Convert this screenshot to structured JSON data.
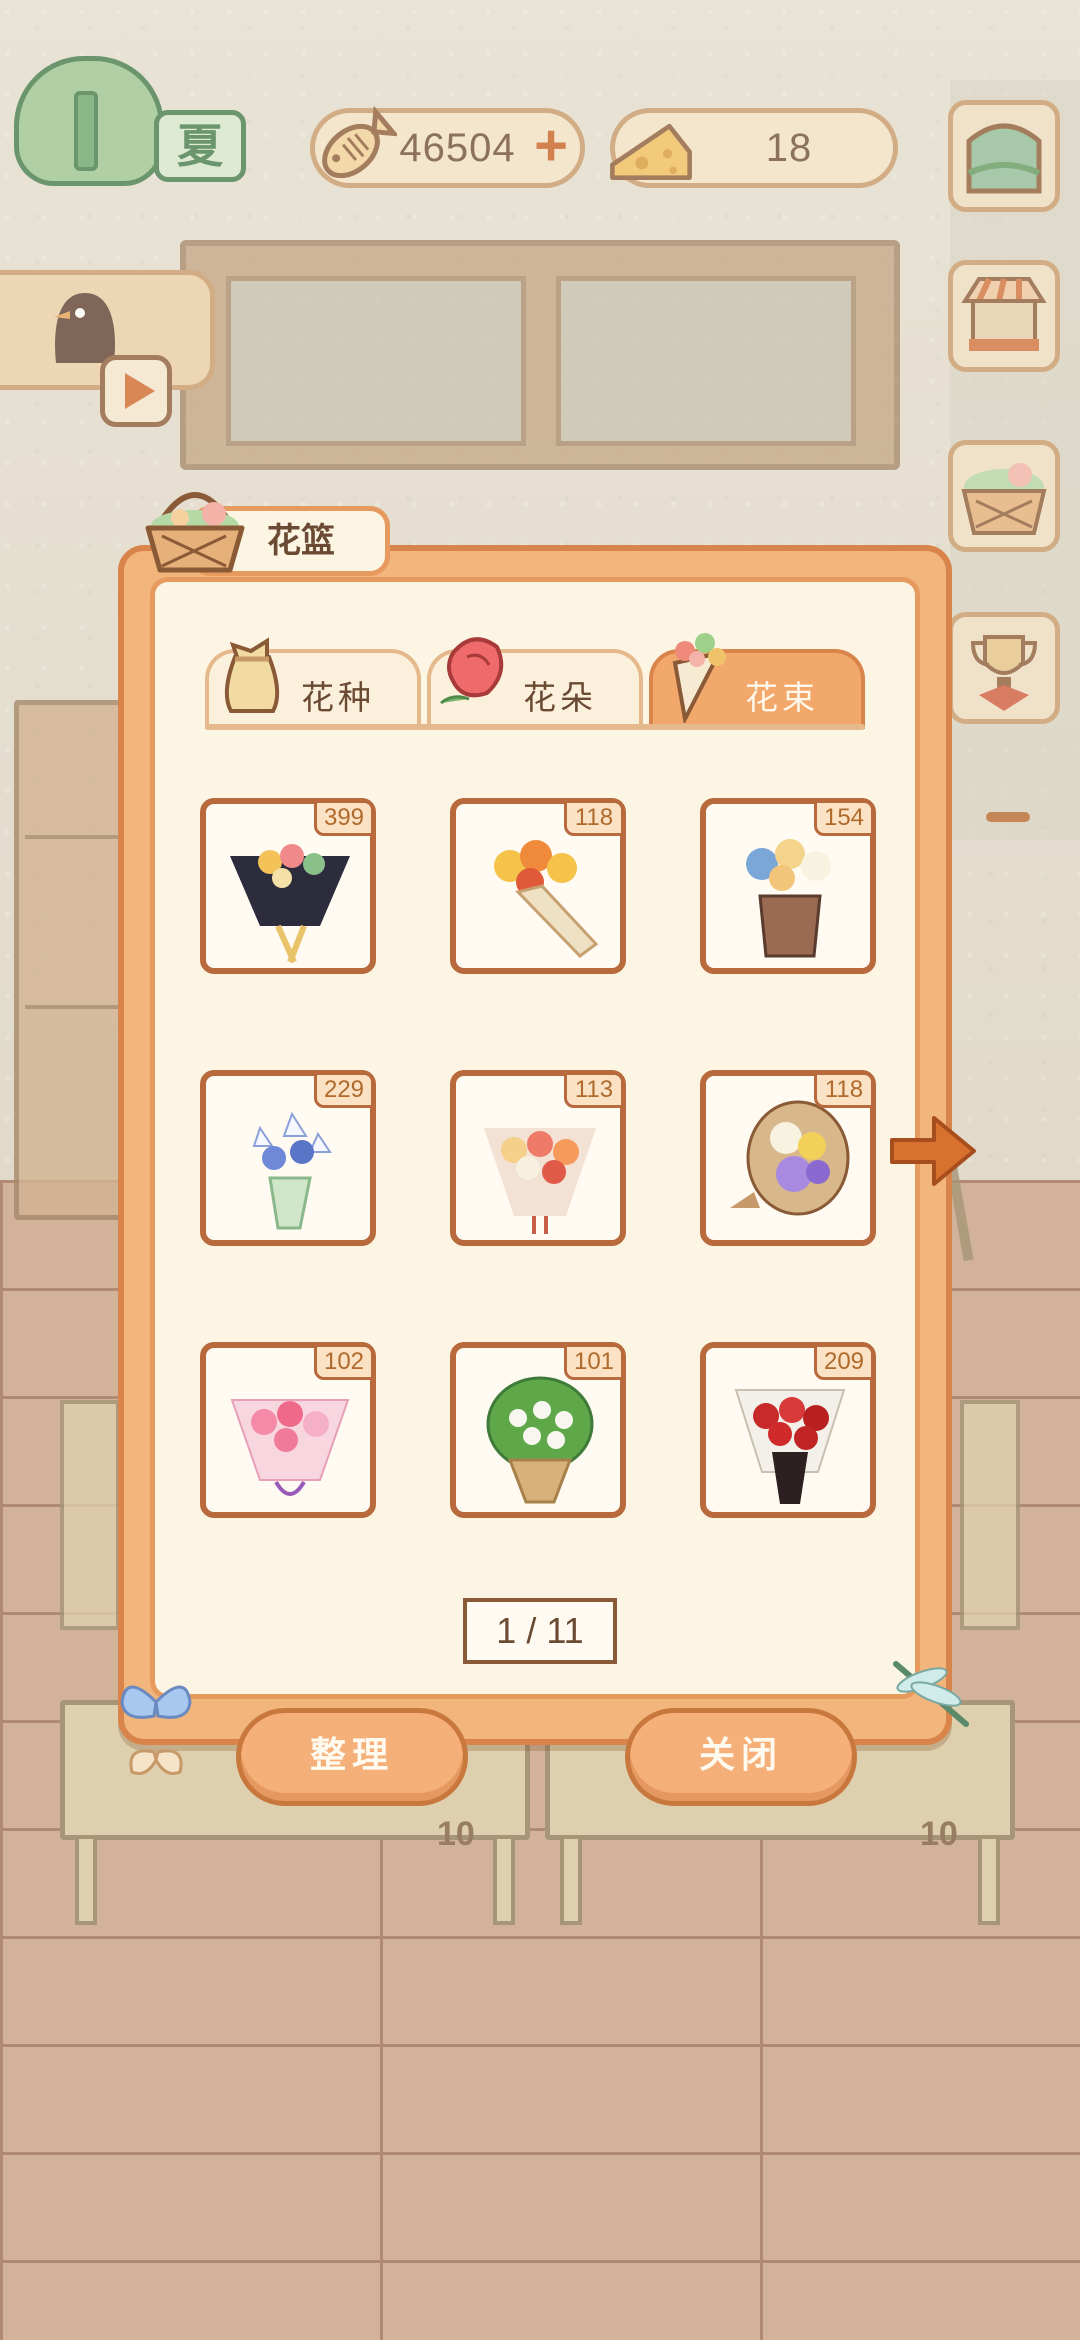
{
  "hud": {
    "season": "夏",
    "fish_coins": "46504",
    "cheese": "18"
  },
  "panel": {
    "title": "花篮",
    "tabs": [
      {
        "label": "花种",
        "active": false
      },
      {
        "label": "花朵",
        "active": false
      },
      {
        "label": "花束",
        "active": true
      }
    ],
    "items": [
      {
        "count": "399",
        "icon": "dark-wrapped-bouquet-icon"
      },
      {
        "count": "118",
        "icon": "yellow-orange-bouquet-icon"
      },
      {
        "count": "154",
        "icon": "blue-hydrangea-pot-icon"
      },
      {
        "count": "229",
        "icon": "blue-lily-bouquet-icon"
      },
      {
        "count": "113",
        "icon": "coral-rose-bouquet-icon"
      },
      {
        "count": "118",
        "icon": "purple-basket-bouquet-icon"
      },
      {
        "count": "102",
        "icon": "pink-bouquet-icon"
      },
      {
        "count": "101",
        "icon": "green-chrysanthemum-bouquet-icon"
      },
      {
        "count": "209",
        "icon": "red-rose-bouquet-icon"
      }
    ],
    "page": "1 / 11",
    "sort_label": "整理",
    "close_label": "关闭"
  },
  "background": {
    "table_left_count": "10",
    "table_right_count": "10"
  },
  "colors": {
    "panel_orange": "#f2b57c",
    "panel_border": "#d8844a",
    "cell_border": "#b86a3c",
    "accent": "#c85e1f"
  }
}
